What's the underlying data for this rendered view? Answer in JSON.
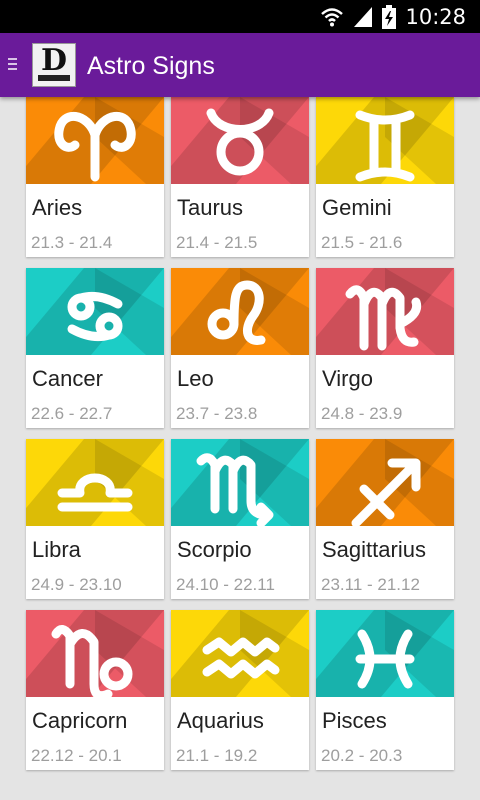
{
  "status_bar": {
    "time": "10:28",
    "icons": [
      "wifi-icon",
      "signal-icon",
      "battery-charging-icon"
    ]
  },
  "app_bar": {
    "title": "Astro Signs",
    "logo_letter": "D",
    "icons": [
      "menu-icon",
      "app-logo"
    ]
  },
  "colors": {
    "orange": "#fa8b07",
    "pink": "#ec5b67",
    "yellow": "#fdd808",
    "teal": "#1ccdc6",
    "purple": "#6a1b9a"
  },
  "signs": [
    {
      "name": "Aries",
      "dates": "21.3 - 21.4",
      "color": "#fa8b07",
      "icon": "aries-icon"
    },
    {
      "name": "Taurus",
      "dates": "21.4 - 21.5",
      "color": "#ec5b67",
      "icon": "taurus-icon"
    },
    {
      "name": "Gemini",
      "dates": "21.5 - 21.6",
      "color": "#fdd808",
      "icon": "gemini-icon"
    },
    {
      "name": "Cancer",
      "dates": "22.6 - 22.7",
      "color": "#1ccdc6",
      "icon": "cancer-icon"
    },
    {
      "name": "Leo",
      "dates": "23.7 - 23.8",
      "color": "#fa8b07",
      "icon": "leo-icon"
    },
    {
      "name": "Virgo",
      "dates": "24.8 - 23.9",
      "color": "#ec5b67",
      "icon": "virgo-icon"
    },
    {
      "name": "Libra",
      "dates": "24.9 - 23.10",
      "color": "#fdd808",
      "icon": "libra-icon"
    },
    {
      "name": "Scorpio",
      "dates": "24.10 - 22.11",
      "color": "#1ccdc6",
      "icon": "scorpio-icon"
    },
    {
      "name": "Sagittarius",
      "dates": "23.11 - 21.12",
      "color": "#fa8b07",
      "icon": "sagittarius-icon"
    },
    {
      "name": "Capricorn",
      "dates": "22.12 - 20.1",
      "color": "#ec5b67",
      "icon": "capricorn-icon"
    },
    {
      "name": "Aquarius",
      "dates": "21.1 - 19.2",
      "color": "#fdd808",
      "icon": "aquarius-icon"
    },
    {
      "name": "Pisces",
      "dates": "20.2 - 20.3",
      "color": "#1ccdc6",
      "icon": "pisces-icon"
    }
  ]
}
